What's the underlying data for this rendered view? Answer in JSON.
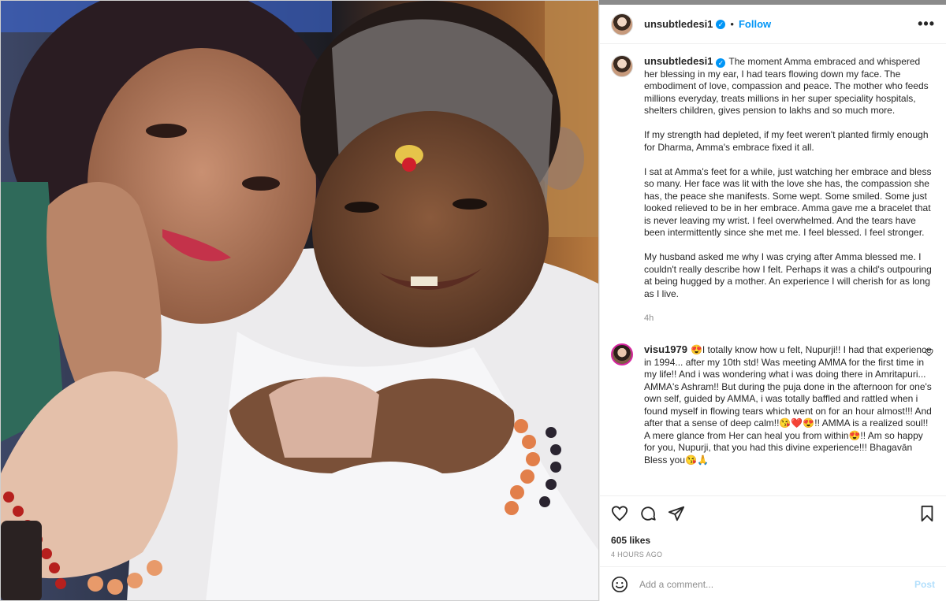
{
  "post": {
    "username": "unsubtledesi1",
    "follow_label": "Follow",
    "more_label": "•••",
    "caption_paragraphs": [
      "The moment Amma embraced and whispered her blessing in my ear, I had tears flowing down my face. The embodiment of love, compassion and peace. The mother who feeds millions everyday, treats millions in her super speciality hospitals, shelters children, gives pension to lakhs and so much more.",
      "If my strength had depleted, if my feet weren't planted firmly enough for Dharma, Amma's embrace fixed it all.",
      "I sat at Amma's feet for a while, just watching her embrace and bless so many. Her face was lit with the love she has, the compassion she has, the peace she manifests. Some wept. Some smiled. Some just looked relieved to be in her embrace. Amma gave me a bracelet that is never leaving my wrist. I feel overwhelmed. And the tears have been intermittently since she met me. I feel blessed. I feel stronger.",
      "My husband asked me why I was crying after Amma blessed me. I couldn't really describe how I felt. Perhaps it was a child's outpouring at being hugged by a mother. An experience I will cherish for as long as I live."
    ],
    "caption_time": "4h",
    "likes": "605 likes",
    "posted_ago": "4 HOURS AGO"
  },
  "comment": {
    "username": "visu1979",
    "text": "😍I totally know how u felt, Nupurji!! I had that experience in 1994... after my 10th std! Was meeting AMMA for the first time in my life!! And i was wondering what i was doing there in Amritapuri... AMMA's Ashram!! But during the puja done in the afternoon for one's own self, guided by AMMA, i was totally baffled and rattled when i found myself in flowing tears which went on for an hour almost!!! And after that a sense of deep calm!!😘❤️😍!! AMMA is a realized soul!! A mere glance from Her can heal you from within😍!! Am so happy for you, Nupurji, that you had this divine experience!!! Bhagavān Bless you😘🙏"
  },
  "input": {
    "placeholder": "Add a comment...",
    "post_label": "Post"
  },
  "colors": {
    "accent": "#0095f6",
    "muted": "#8e8e8e",
    "post_disabled": "#b2dffc"
  }
}
